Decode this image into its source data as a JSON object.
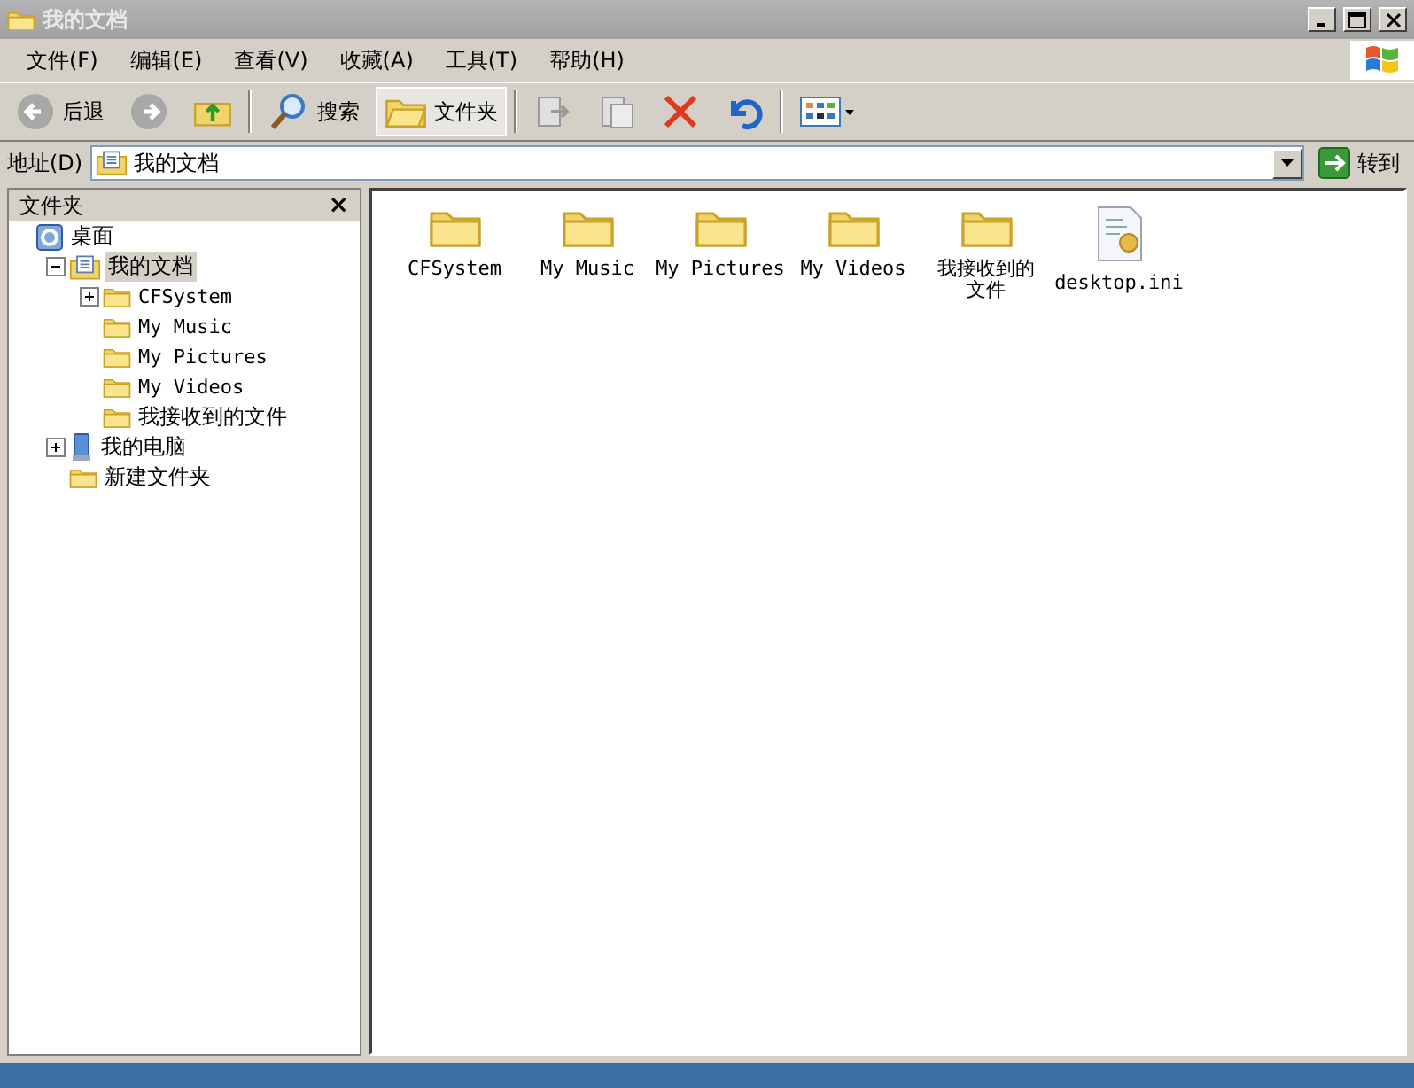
{
  "window": {
    "title": "我的文档"
  },
  "menu": [
    "文件(F)",
    "编辑(E)",
    "查看(V)",
    "收藏(A)",
    "工具(T)",
    "帮助(H)"
  ],
  "toolbar": {
    "back": "后退",
    "search": "搜索",
    "folders": {
      "label": "文件夹",
      "selected": true
    }
  },
  "address": {
    "label": "地址(D)",
    "value": "我的文档",
    "go": "转到"
  },
  "folder_pane": {
    "title": "文件夹",
    "close": "×",
    "tree": [
      {
        "label": "桌面",
        "kind": "desktop",
        "selected": false,
        "children": [
          {
            "label": "我的文档",
            "kind": "documents",
            "selected": true,
            "expanded": true,
            "children": [
              {
                "label": "CFSystem",
                "kind": "folder",
                "selected": false,
                "expanded": false
              },
              {
                "label": "My Music",
                "kind": "folder",
                "selected": false
              },
              {
                "label": "My Pictures",
                "kind": "folder",
                "selected": false
              },
              {
                "label": "My Videos",
                "kind": "folder",
                "selected": false
              },
              {
                "label": "我接收到的文件",
                "kind": "folder",
                "selected": false
              }
            ]
          },
          {
            "label": "我的电脑",
            "kind": "computer",
            "selected": false,
            "expanded": false
          },
          {
            "label": "新建文件夹",
            "kind": "folder",
            "selected": false
          }
        ]
      }
    ]
  },
  "files": [
    {
      "name": "CFSystem",
      "kind": "folder"
    },
    {
      "name": "My Music",
      "kind": "folder"
    },
    {
      "name": "My Pictures",
      "kind": "folder"
    },
    {
      "name": "My Videos",
      "kind": "folder"
    },
    {
      "name": "我接收到的文件",
      "kind": "folder"
    },
    {
      "name": "desktop.ini",
      "kind": "file"
    }
  ]
}
